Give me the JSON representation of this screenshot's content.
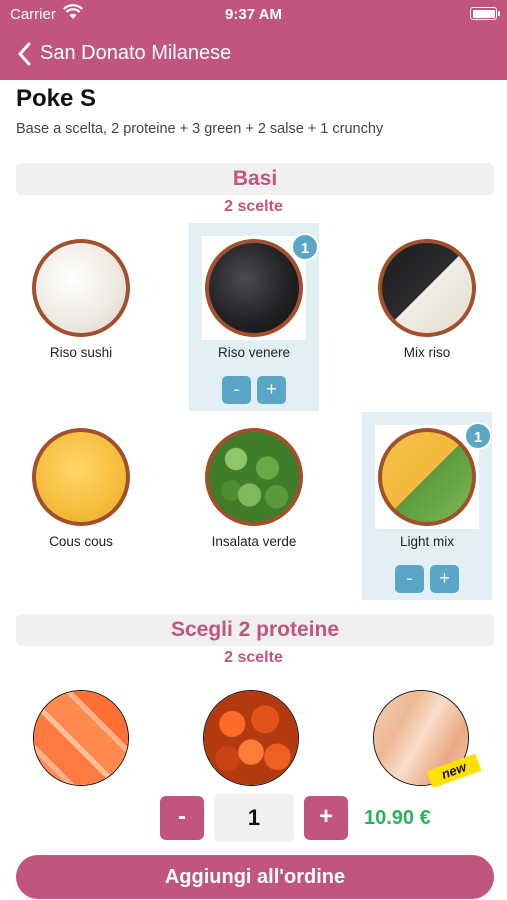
{
  "status": {
    "carrier": "Carrier",
    "time": "9:37 AM"
  },
  "nav": {
    "title": "San Donato Milanese"
  },
  "product": {
    "name": "Poke S",
    "description": "Base a scelta, 2 proteine + 3 green + 2 salse + 1 crunchy"
  },
  "sections": {
    "basi": {
      "title": "Basi",
      "subtitle": "2 scelte",
      "items": [
        {
          "label": "Riso sushi",
          "selected": false
        },
        {
          "label": "Riso venere",
          "selected": true,
          "count": "1"
        },
        {
          "label": "Mix riso",
          "selected": false
        },
        {
          "label": "Cous cous",
          "selected": false
        },
        {
          "label": "Insalata verde",
          "selected": false
        },
        {
          "label": "Light mix",
          "selected": true,
          "count": "1"
        }
      ],
      "minus": "-",
      "plus": "+"
    },
    "proteine": {
      "title": "Scegli 2 proteine",
      "subtitle": "2 scelte",
      "new_tag": "new"
    }
  },
  "order": {
    "minus": "-",
    "plus": "+",
    "quantity": "1",
    "price": "10.90 €",
    "add_button": "Aggiungi all'ordine"
  },
  "colors": {
    "brand": "#c2557f",
    "accent": "#5aa6c7",
    "price": "#2bb35a"
  }
}
